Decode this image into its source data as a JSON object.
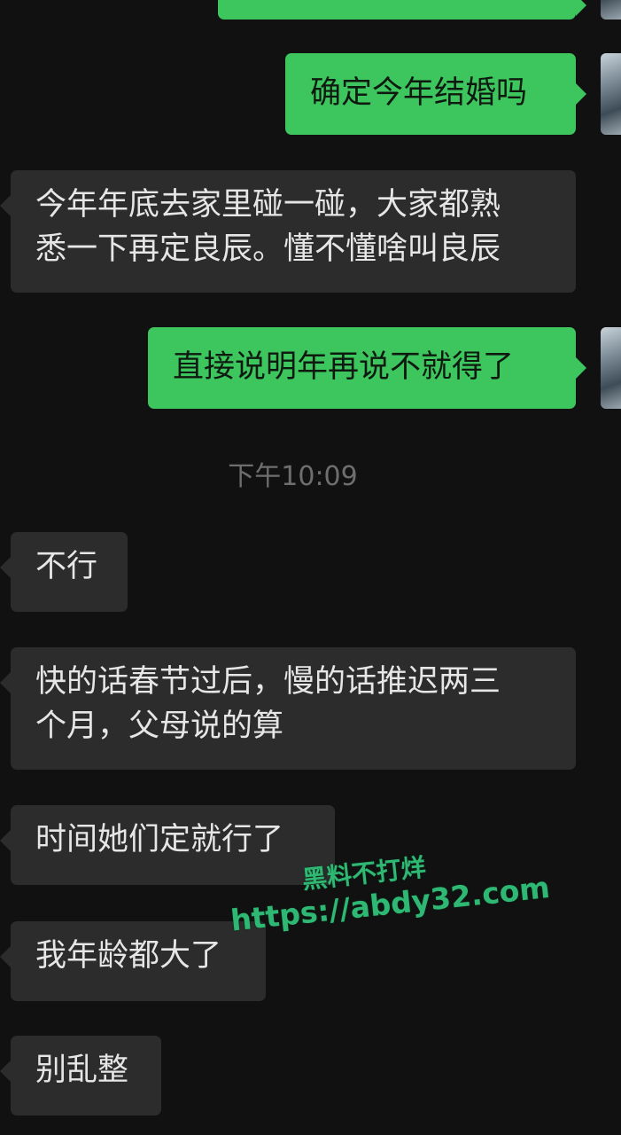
{
  "messages": [
    {
      "side": "out",
      "text": "确定今年结婚吗"
    },
    {
      "side": "in",
      "lines": [
        "今年年底去家里碰一碰，大家都熟",
        "悉一下再定良辰。懂不懂啥叫良辰"
      ]
    },
    {
      "side": "out",
      "text": "直接说明年再说不就得了"
    },
    {
      "side": "in",
      "text": "不行"
    },
    {
      "side": "in",
      "lines": [
        "快的话春节过后，慢的话推迟两三",
        "个月，父母说的算"
      ]
    },
    {
      "side": "in",
      "text": "时间她们定就行了"
    },
    {
      "side": "in",
      "text": "我年龄都大了"
    },
    {
      "side": "in",
      "text": "别乱整"
    }
  ],
  "timestamp": "下午10:09",
  "watermark": {
    "title": "黑料不打烊",
    "url": "https://abdy32.com"
  },
  "colors": {
    "background": "#111111",
    "incoming_bubble": "#2c2c2c",
    "outgoing_bubble": "#3ec65e",
    "watermark": "#2fb873"
  }
}
